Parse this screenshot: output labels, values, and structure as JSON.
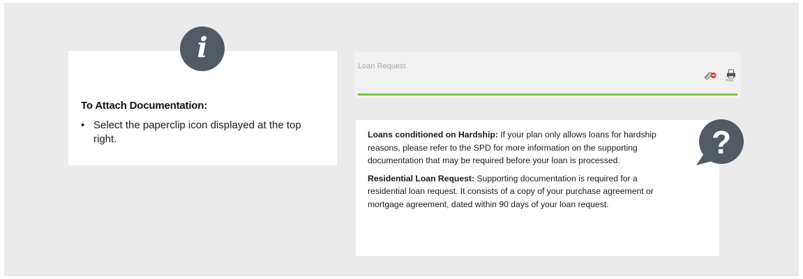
{
  "instruction_card": {
    "heading": "To Attach Documentation:",
    "bullet_symbol": "•",
    "bullet_text": "Select the paperclip icon displayed at the top right.",
    "badge_icon": "info-icon",
    "badge_glyph": "i",
    "badge_color": "#525a63"
  },
  "loan_panel": {
    "title": "Loan Request",
    "underline_color": "#7dc242",
    "attach_icon": "paperclip-icon",
    "print_icon": "printer-icon",
    "print_label": "Print"
  },
  "help_card": {
    "icon": "question-bubble-icon",
    "icon_glyph": "?",
    "items": [
      {
        "title": "Loans conditioned on Hardship:",
        "text": " If your plan only allows loans for hardship reasons, please refer to the SPD for more information on the supporting documentation that may be required before your loan is processed."
      },
      {
        "title": "Residential Loan Request:",
        "text": " Supporting documentation is required for a residential loan request. It consists of a copy of your purchase agreement or mortgage agreement, dated within 90 days of your loan request."
      }
    ]
  }
}
